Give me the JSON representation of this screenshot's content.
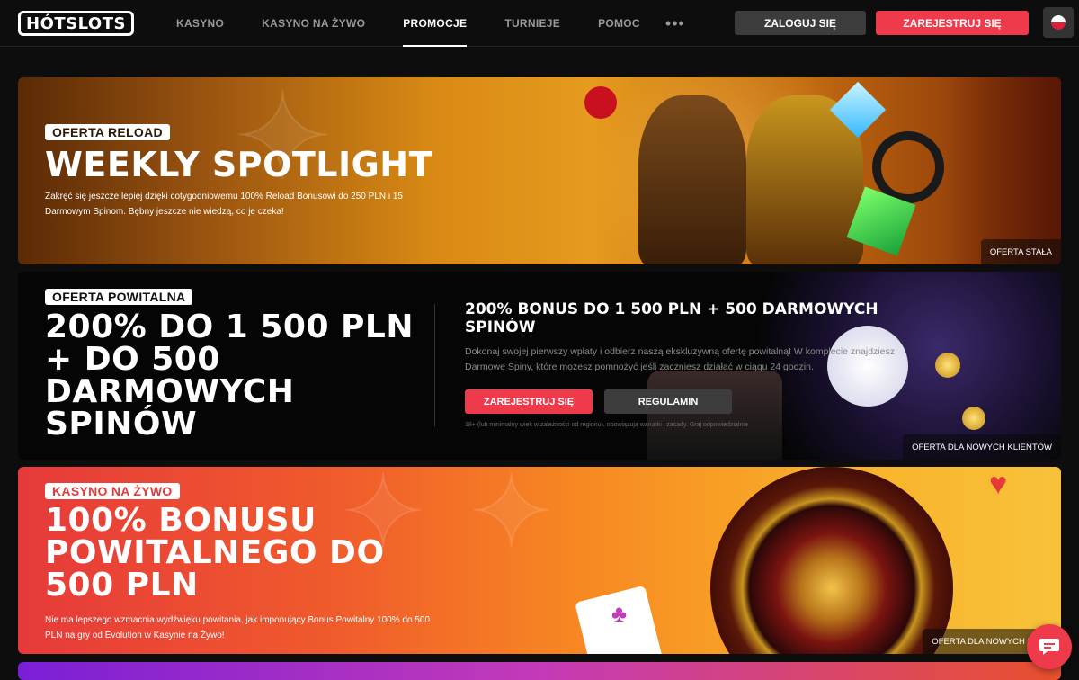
{
  "header": {
    "logo": "HÓTSLOTS",
    "nav": [
      {
        "label": "KASYNO",
        "active": false
      },
      {
        "label": "KASYNO NA ŻYWO",
        "active": false
      },
      {
        "label": "PROMOCJE",
        "active": true
      },
      {
        "label": "TURNIEJE",
        "active": false
      },
      {
        "label": "POMOC",
        "active": false
      }
    ],
    "more_icon": "more-dots-icon",
    "login_label": "ZALOGUJ SIĘ",
    "register_label": "ZAREJESTRUJ SIĘ",
    "language_icon": "poland-flag-icon"
  },
  "banners": [
    {
      "badge": "OFERTA RELOAD",
      "title": "WEEKLY SPOTLIGHT",
      "description": "Zakręć się jeszcze lepiej dzięki cotygodniowemu 100% Reload Bonusowi do 250 PLN i 15 Darmowym Spinom. Bębny jeszcze nie wiedzą, co je czeka!",
      "tag": "OFERTA STAŁA"
    },
    {
      "badge": "OFERTA POWITALNA",
      "title_lines": [
        "200% DO 1 500 PLN",
        "+ DO 500",
        "DARMOWYCH",
        "SPINÓW"
      ],
      "side_title": "200% BONUS DO 1 500 PLN + 500 DARMOWYCH SPINÓW",
      "side_description": "Dokonaj swojej pierwszy wpłaty i odbierz naszą ekskluzywną ofertę powitalną! W komplecie znajdziesz Darmowe Spiny, które możesz pomnożyć jeśli zaczniesz działać w ciągu 24 godzin.",
      "register_label": "ZAREJESTRUJ SIĘ",
      "rules_label": "REGULAMIN",
      "note": "18+ (lub minimalny wiek w zależności od regionu), obowiązują warunki i zasady. Graj odpowiedzialnie",
      "tag": "OFERTA DLA NOWYCH KLIENTÓW"
    },
    {
      "badge": "KASYNO NA ŻYWO",
      "title_lines": [
        "100% BONUSU",
        "POWITALNEGO DO",
        "500 PLN"
      ],
      "description": "Nie ma lepszego wzmacnia wydźwięku powitania, jak imponujący Bonus Powitalny 100% do 500 PLN na gry od Evolution w Kasynie na Żywo!",
      "tag": "OFERTA DLA NOWYCH KLIEN"
    }
  ],
  "chat_icon": "chat-bubble-icon",
  "colors": {
    "accent_red": "#ee3a4b",
    "dark_button": "#3c3c3c",
    "background": "#0d0d0d"
  }
}
